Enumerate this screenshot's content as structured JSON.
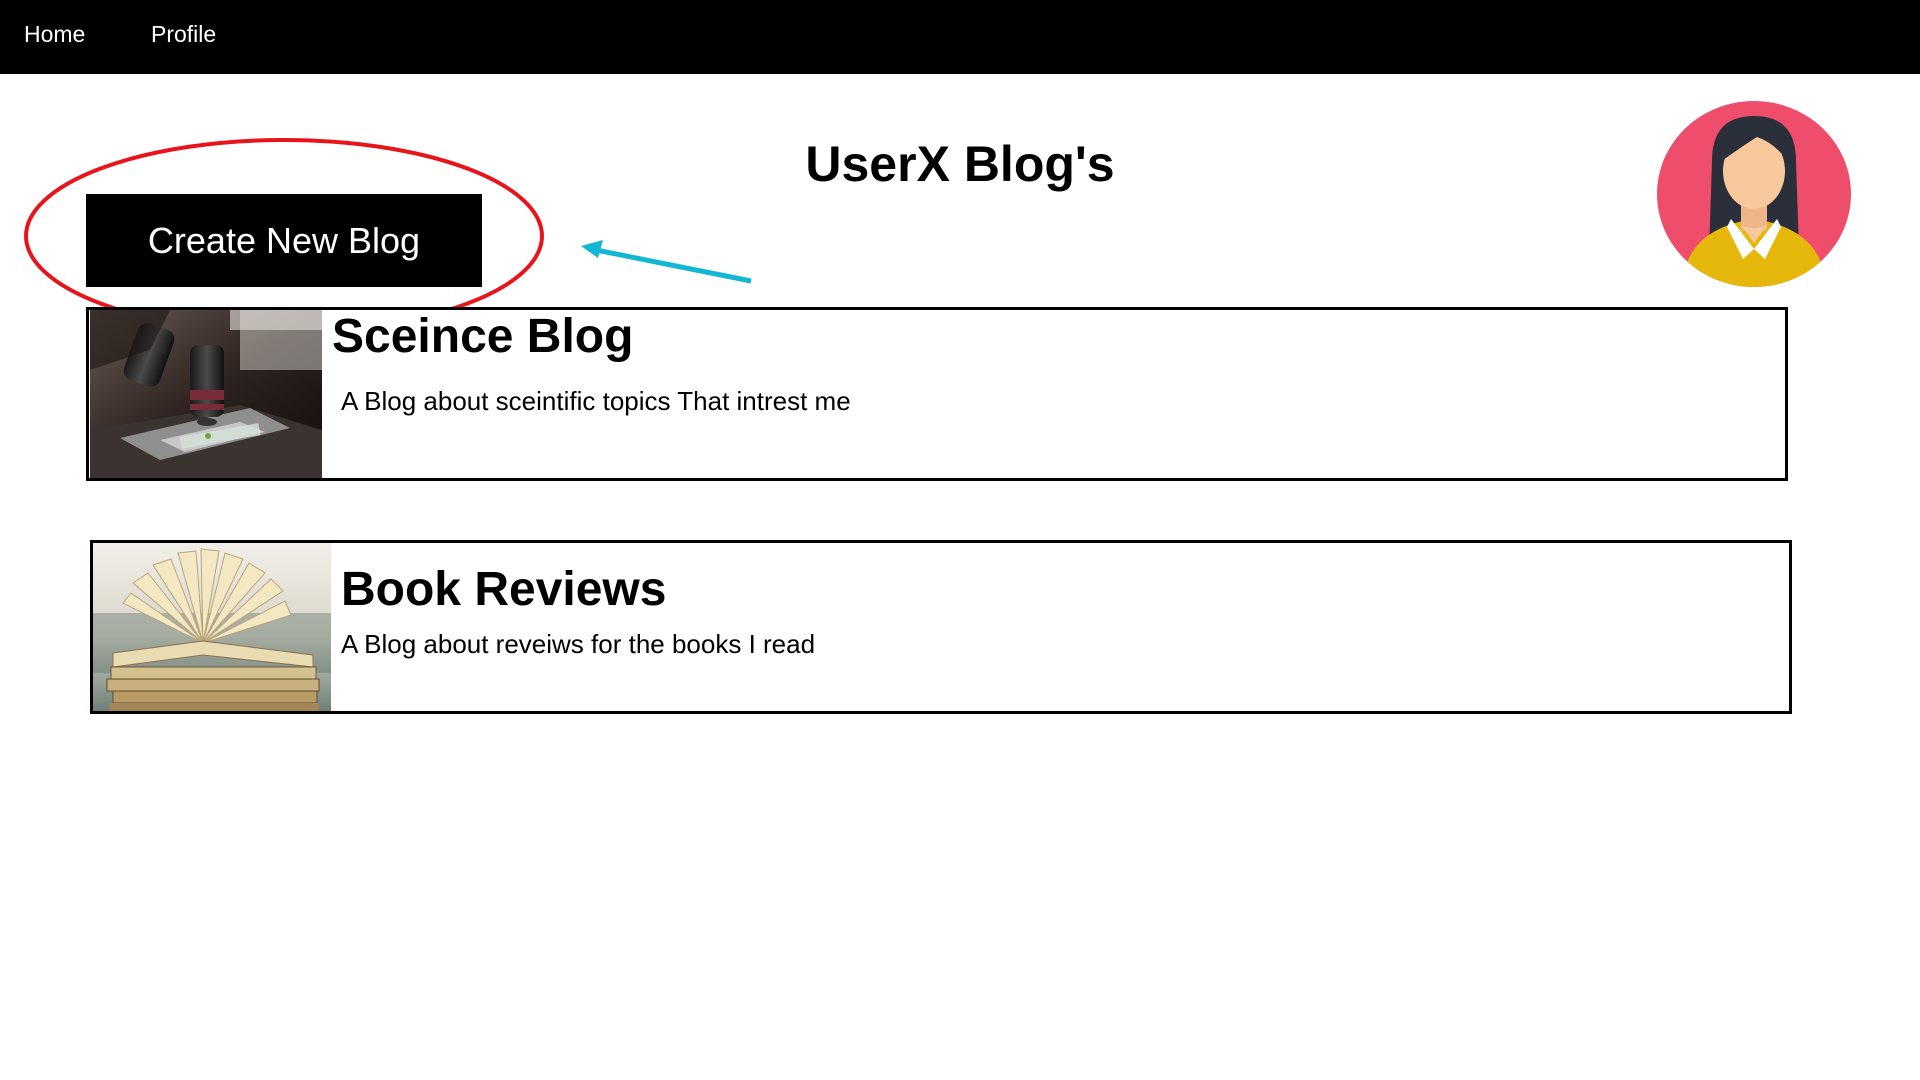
{
  "nav": {
    "home_label": "Home",
    "profile_label": "Profile"
  },
  "page": {
    "title": "UserX Blog's"
  },
  "actions": {
    "create_label": "Create New Blog"
  },
  "avatar": {
    "icon": "user-avatar-icon",
    "bg_color": "#EE4E6B",
    "shirt_color": "#E6B80B",
    "hair_color": "#2B2F3A",
    "skin_color": "#F7C99C"
  },
  "annotations": {
    "circle_color": "#E8141B",
    "arrow_color": "#12B7D4"
  },
  "blogs": [
    {
      "title": "Sceince Blog",
      "description": "A Blog about sceintific topics That intrest me",
      "thumbnail": "microscope-image"
    },
    {
      "title": "Book Reviews",
      "description": "A Blog about reveiws for the books I read",
      "thumbnail": "books-image"
    }
  ]
}
